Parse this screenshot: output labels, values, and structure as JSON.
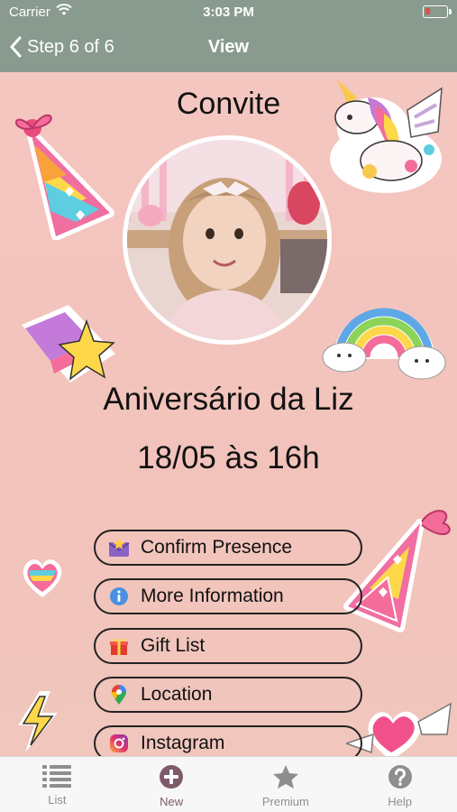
{
  "status_bar": {
    "carrier": "Carrier",
    "time": "3:03 PM"
  },
  "nav": {
    "back_label": "Step 6 of 6",
    "title": "View"
  },
  "invite": {
    "title": "Convite",
    "event_name": "Aniversário da Liz",
    "event_date": "18/05 às 16h"
  },
  "actions": [
    {
      "label": "Confirm Presence",
      "icon": "envelope-star-icon"
    },
    {
      "label": "More Information",
      "icon": "info-icon"
    },
    {
      "label": "Gift List",
      "icon": "gift-icon"
    },
    {
      "label": "Location",
      "icon": "map-pin-icon"
    },
    {
      "label": "Instagram",
      "icon": "instagram-icon"
    }
  ],
  "tabs": [
    {
      "label": "List",
      "icon": "list-icon"
    },
    {
      "label": "New",
      "icon": "plus-circle-icon"
    },
    {
      "label": "Premium",
      "icon": "star-icon"
    },
    {
      "label": "Help",
      "icon": "question-circle-icon"
    }
  ],
  "colors": {
    "nav_bar": "#899a8f",
    "background": "#f2c8c2",
    "tab_active": "#7d5a6a"
  }
}
